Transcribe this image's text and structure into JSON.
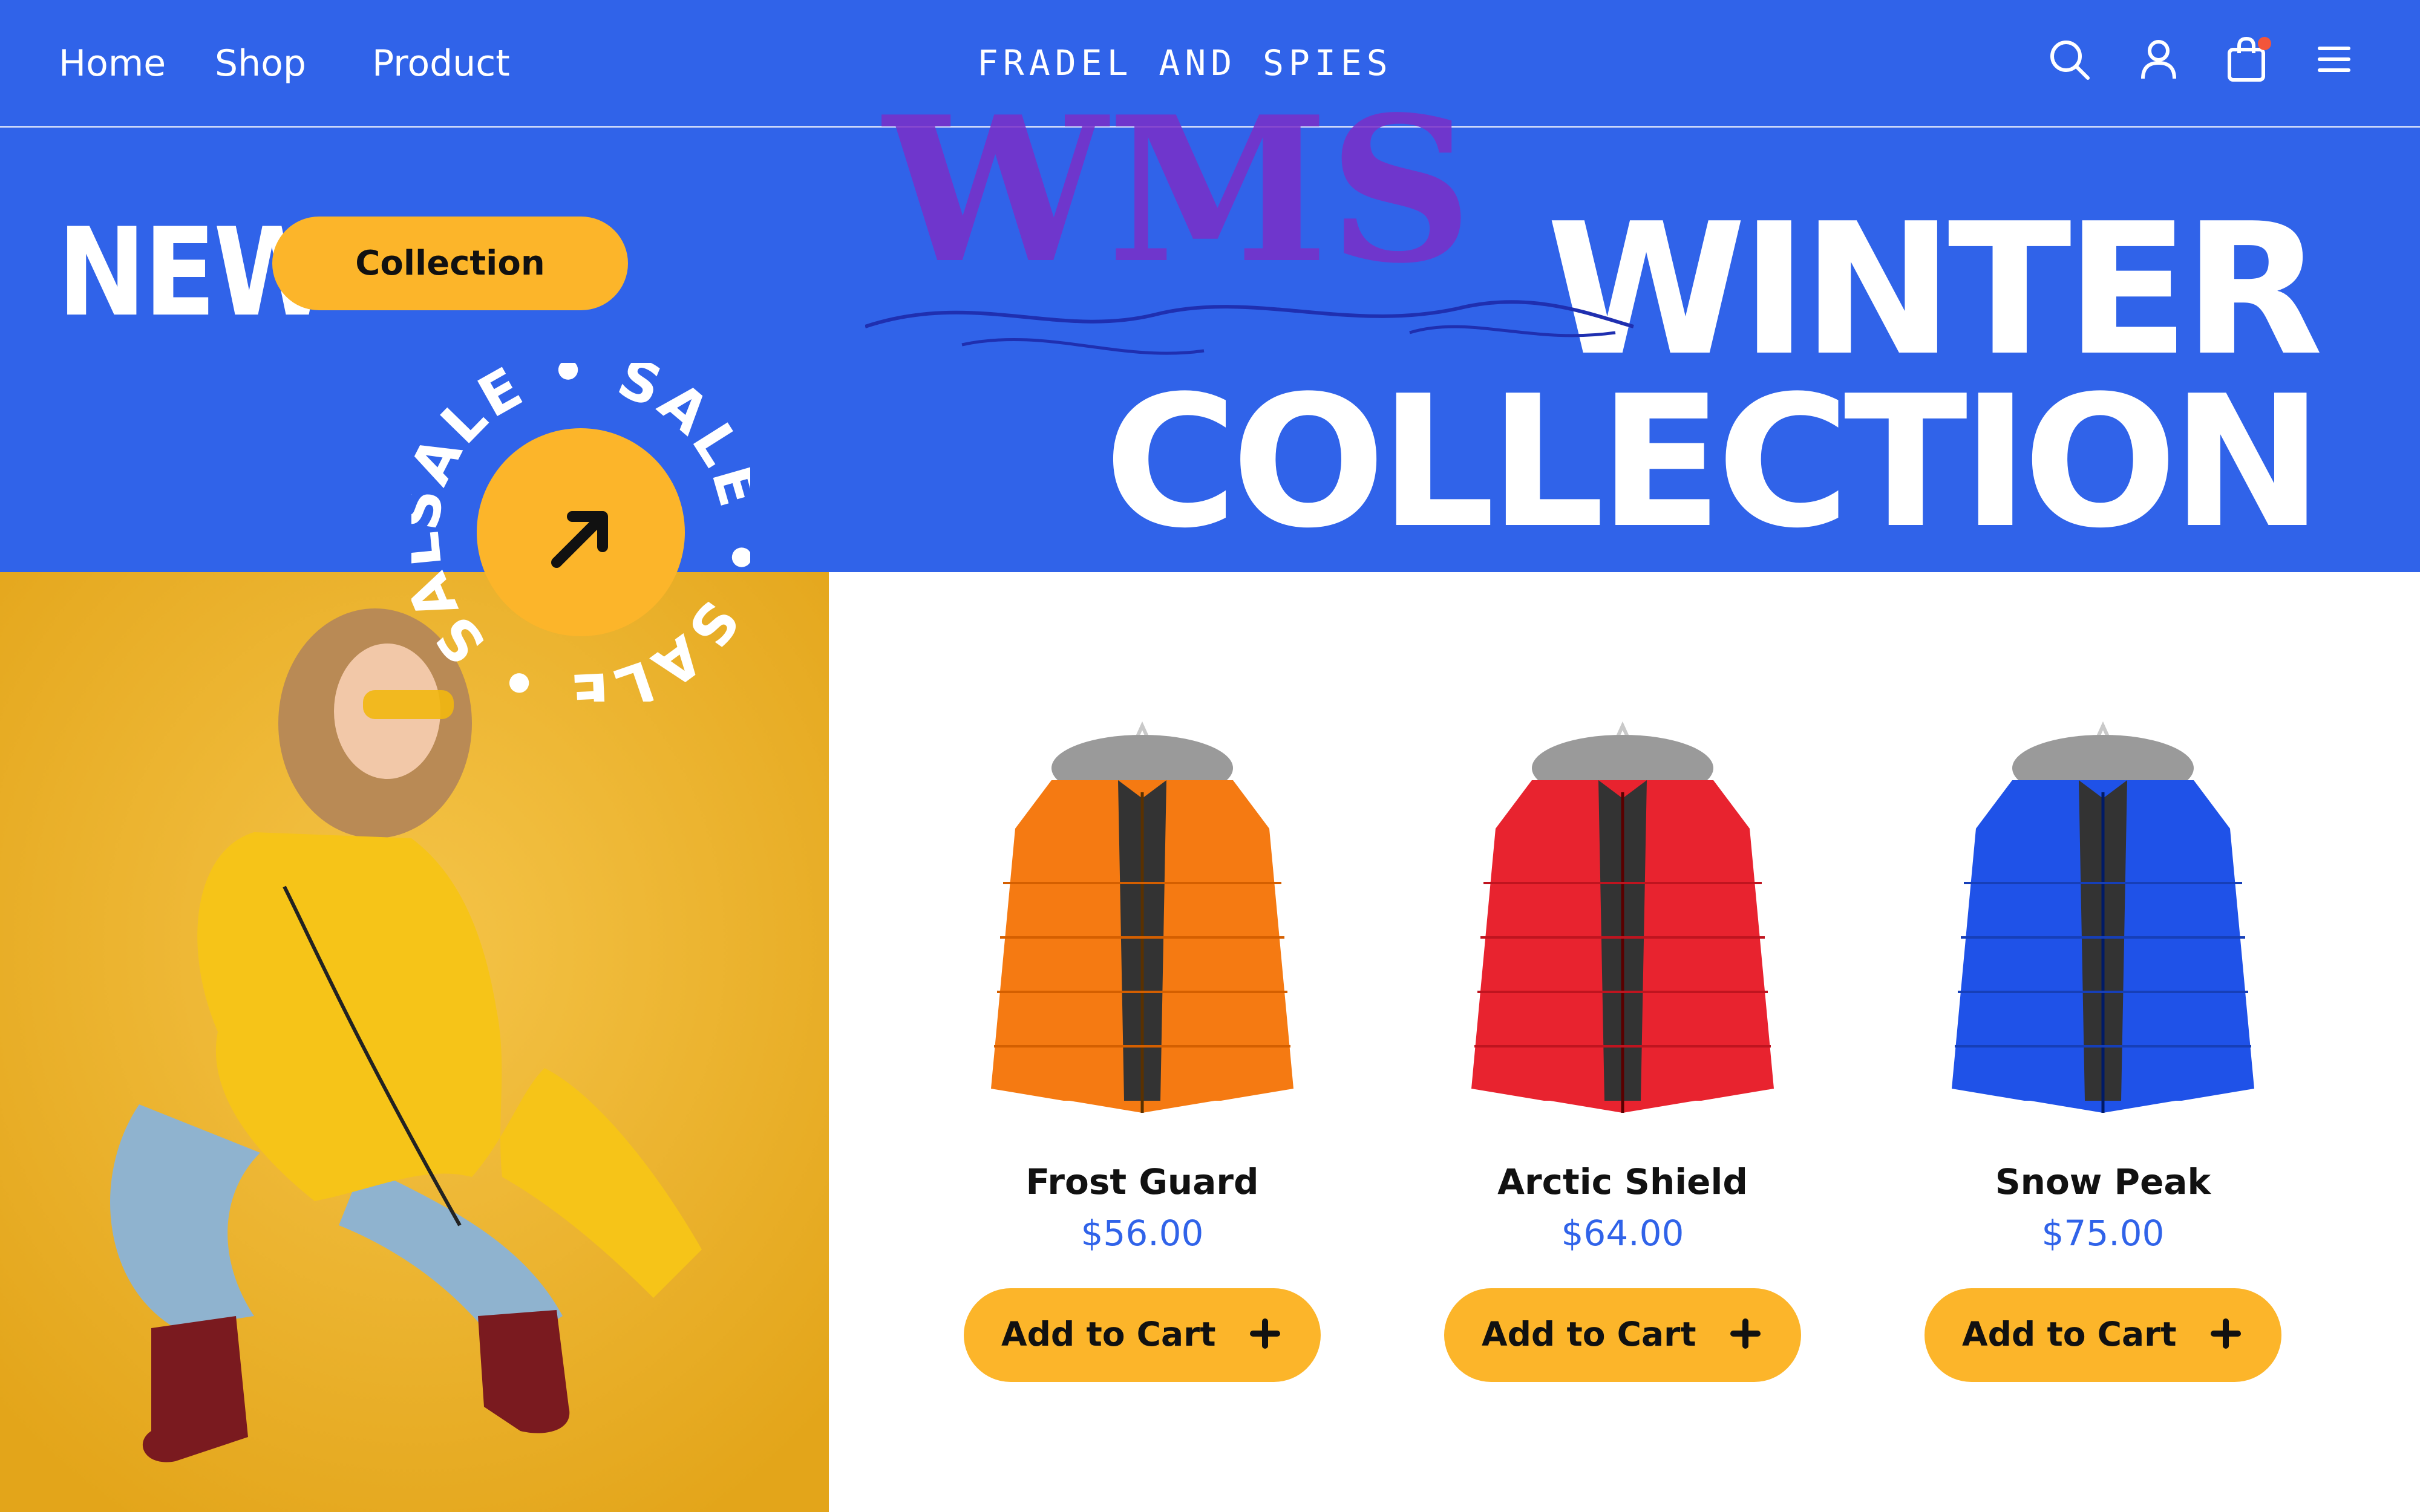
{
  "header": {
    "nav": [
      {
        "label": "Home"
      },
      {
        "label": "Shop"
      },
      {
        "label": "Product"
      }
    ],
    "brand": "FRADEL AND SPIES",
    "icons": [
      "search-icon",
      "user-icon",
      "shopping-bag-icon",
      "menu-icon"
    ],
    "cart_has_notification": true
  },
  "hero": {
    "new_label": "NEW",
    "collection_button": "Collection",
    "headline_line1": "WINTER",
    "headline_line2": "COLLECTION",
    "watermark_text": "WMS"
  },
  "sale_badge": {
    "ring_text": "SALE • SALE • SALE • SALE •",
    "icon": "arrow-up-right-icon"
  },
  "products": [
    {
      "name": "Frost Guard",
      "price": "$56.00",
      "button": "Add to Cart",
      "color": "#F57A12"
    },
    {
      "name": "Arctic Shield",
      "price": "$64.00",
      "button": "Add to Cart",
      "color": "#E8232F"
    },
    {
      "name": "Snow Peak",
      "price": "$75.00",
      "button": "Add to Cart",
      "color": "#1F52E8"
    }
  ],
  "colors": {
    "primary_blue": "#3063E9",
    "accent_yellow": "#FCB52A",
    "notification_dot": "#F3553A"
  }
}
